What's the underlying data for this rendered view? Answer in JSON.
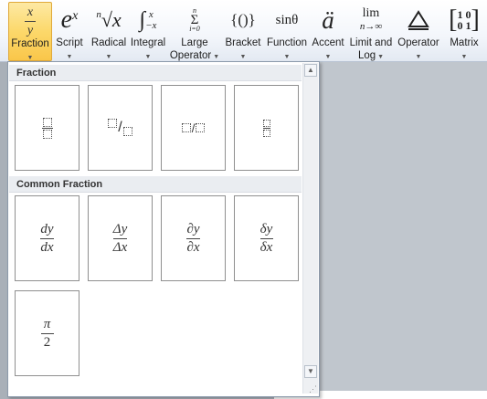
{
  "ribbon": {
    "buttons": [
      {
        "name": "fraction",
        "glyph": "x/y",
        "label": "Fraction",
        "dropdown": true,
        "active": true
      },
      {
        "name": "script",
        "glyph": "e^x",
        "label": "Script",
        "dropdown": true
      },
      {
        "name": "radical",
        "glyph": "n√x",
        "label": "Radical",
        "dropdown": true
      },
      {
        "name": "integral",
        "glyph": "∫x −x",
        "label": "Integral",
        "dropdown": true
      },
      {
        "name": "large-operator",
        "glyph": "Σ",
        "label": "Large Operator",
        "dropdown": true
      },
      {
        "name": "bracket",
        "glyph": "{()}",
        "label": "Bracket",
        "dropdown": true
      },
      {
        "name": "function",
        "glyph": "sinθ",
        "label": "Function",
        "dropdown": true
      },
      {
        "name": "accent",
        "glyph": "ä",
        "label": "Accent",
        "dropdown": true
      },
      {
        "name": "limit-and-log",
        "glyph": "lim n→∞",
        "label": "Limit and Log",
        "dropdown": true
      },
      {
        "name": "operator",
        "glyph": "△",
        "label": "Operator",
        "dropdown": true
      },
      {
        "name": "matrix",
        "glyph": "[10 01]",
        "label": "Matrix",
        "dropdown": true
      }
    ],
    "active_color": "#fcd86a"
  },
  "gallery": {
    "sections": [
      {
        "title": "Fraction"
      },
      {
        "title": "Common Fraction"
      }
    ],
    "common_fractions": [
      {
        "num": "dy",
        "den": "dx"
      },
      {
        "num": "Δy",
        "den": "Δx"
      },
      {
        "num": "∂y",
        "den": "∂x"
      },
      {
        "num": "δy",
        "den": "δx"
      },
      {
        "num": "π",
        "den": "2"
      }
    ]
  }
}
